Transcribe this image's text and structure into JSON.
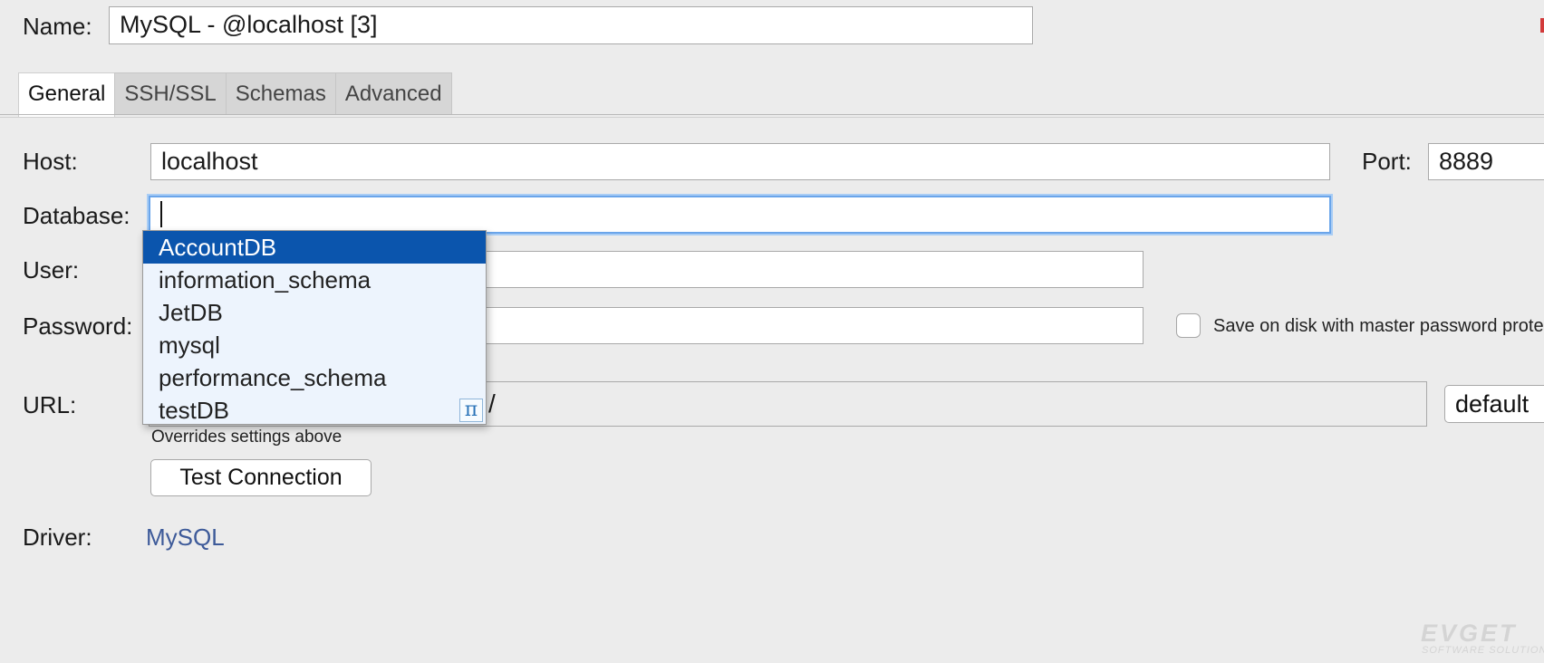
{
  "name": {
    "label": "Name:",
    "value": "MySQL - @localhost [3]"
  },
  "tabs": [
    {
      "label": "General",
      "active": true
    },
    {
      "label": "SSH/SSL",
      "active": false
    },
    {
      "label": "Schemas",
      "active": false
    },
    {
      "label": "Advanced",
      "active": false
    }
  ],
  "host": {
    "label": "Host:",
    "value": "localhost"
  },
  "port": {
    "label": "Port:",
    "value": "8889"
  },
  "database": {
    "label": "Database:",
    "value": ""
  },
  "autocomplete": {
    "items": [
      "AccountDB",
      "information_schema",
      "JetDB",
      "mysql",
      "performance_schema",
      "testDB"
    ],
    "selected": "AccountDB",
    "icon": "pi-icon",
    "icon_glyph": "π"
  },
  "user": {
    "label": "User:",
    "value": ""
  },
  "password": {
    "label": "Password:",
    "value": "",
    "save_label": "Save on disk with master password prote"
  },
  "url": {
    "label": "URL:",
    "visible_value": "/",
    "hint": "Overrides settings above",
    "mode_button": "default"
  },
  "test_connection_label": "Test Connection",
  "driver": {
    "label": "Driver:",
    "value": "MySQL"
  },
  "watermark": {
    "text": "EVGET",
    "subtext": "SOFTWARE SOLUTIONS"
  },
  "colors": {
    "selection": "#0b55ad",
    "focus_ring": "#6aa5ea",
    "driver_link": "#3d5a99",
    "popup_bg": "#edf4fd"
  }
}
